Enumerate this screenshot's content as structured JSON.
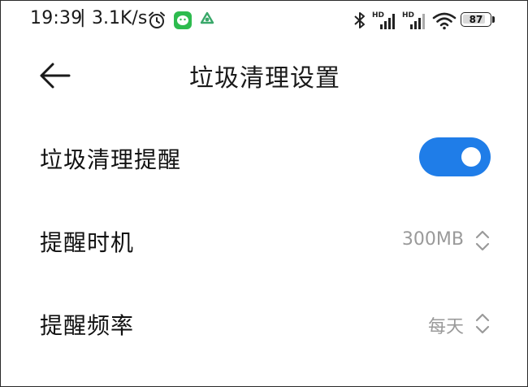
{
  "status_bar": {
    "time": "19:39",
    "separator": "|",
    "net_speed": "3.1K/s",
    "battery_level": 87,
    "battery_text": "87",
    "icons": [
      "alarm-icon",
      "wechat-icon",
      "sync-icon",
      "bluetooth-icon",
      "hd-signal-icon",
      "hd-signal-icon",
      "wifi-icon",
      "battery-icon"
    ]
  },
  "header": {
    "title": "垃圾清理设置",
    "back_icon": "back-arrow-icon"
  },
  "settings": {
    "reminder": {
      "label": "垃圾清理提醒",
      "enabled": true
    },
    "timing": {
      "label": "提醒时机",
      "value": "300MB"
    },
    "frequency": {
      "label": "提醒频率",
      "value": "每天"
    }
  },
  "colors": {
    "accent": "#1f7de8",
    "secondary_text": "#9a9a9a",
    "wechat_green": "#2dbb4e"
  }
}
